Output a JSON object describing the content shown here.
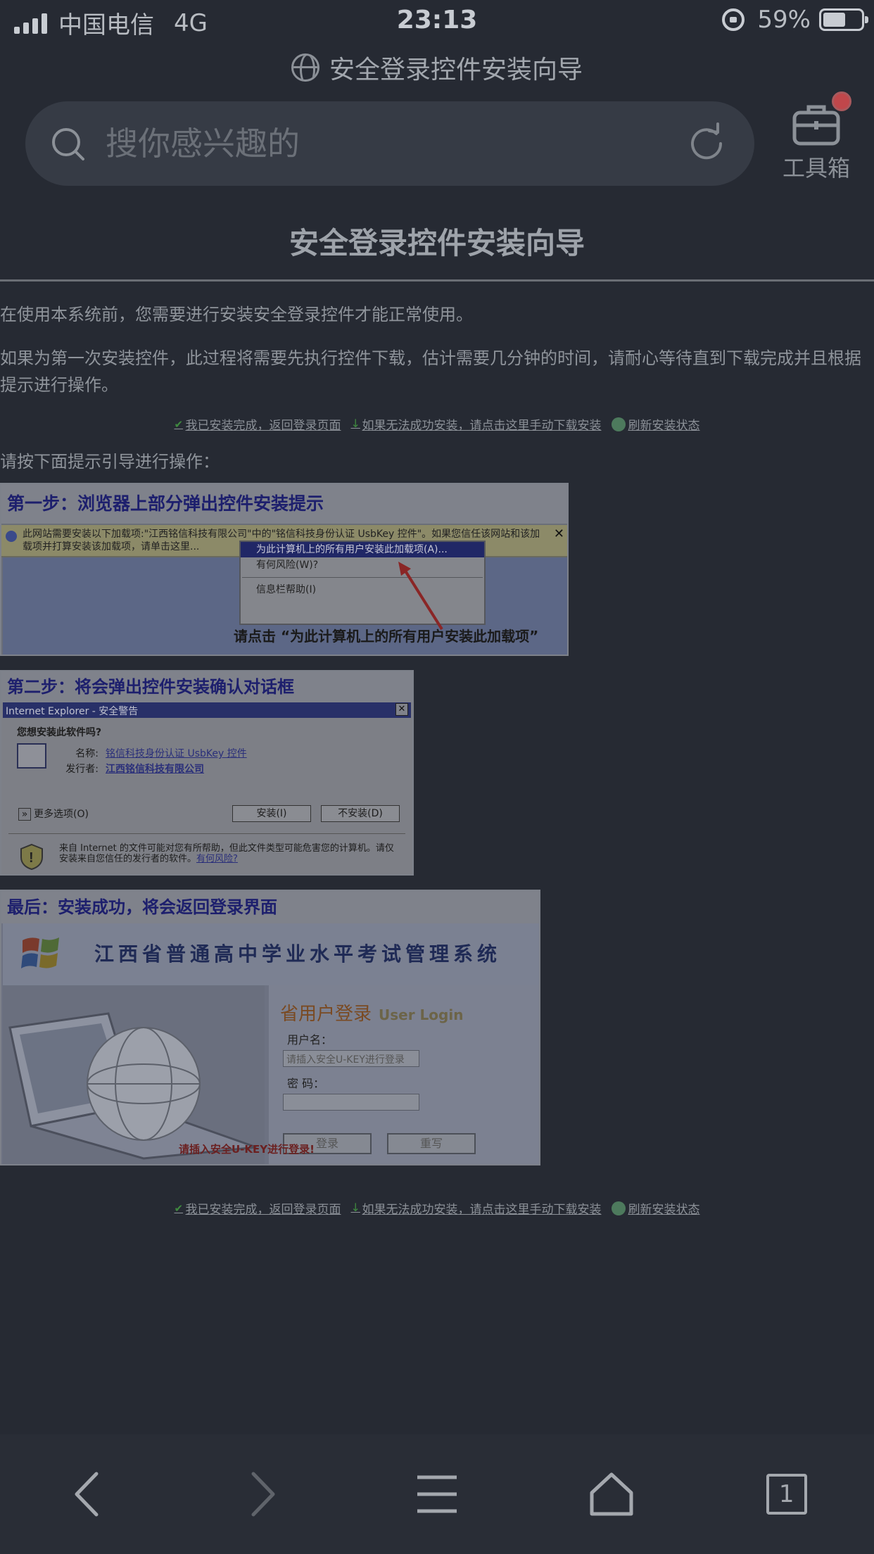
{
  "status_bar": {
    "carrier": "中国电信",
    "network": "4G",
    "time": "23:13",
    "battery_percent": "59%",
    "battery_level": 0.59
  },
  "page_title": "安全登录控件安装向导",
  "search": {
    "placeholder": "搜你感兴趣的"
  },
  "toolbox": {
    "label": "工具箱"
  },
  "content": {
    "title": "安全登录控件安装向导",
    "para1": "在使用本系统前，您需要进行安装安全登录控件才能正常使用。",
    "para2": "如果为第一次安装控件，此过程将需要先执行控件下载，估计需要几分钟的时间，请耐心等待直到下载完成并且根据提示进行操作。",
    "links": {
      "done": "我已安装完成，返回登录页面",
      "manual": "如果无法成功安装，请点击这里手动下载安装",
      "refresh": "刷新安装状态"
    },
    "guide_intro": "请按下面提示引导进行操作："
  },
  "step1": {
    "heading": "第一步：浏览器上部分弹出控件安装提示",
    "infobar_text": "此网站需要安装以下加载项:\"江西铭信科技有限公司\"中的\"铭信科技身份认证 UsbKey 控件\"。如果您信任该网站和该加载项并打算安装该加载项，请单击这里...",
    "menu_item1": "为此计算机上的所有用户安装此加载项(A)...",
    "menu_item2": "有何风险(W)?",
    "menu_item3": "信息栏帮助(I)",
    "note": "请点击 “为此计算机上的所有用户安装此加载项”"
  },
  "step2": {
    "heading": "第二步：将会弹出控件安装确认对话框",
    "dialog_title": "Internet Explorer - 安全警告",
    "question": "您想安装此软件吗?",
    "name_label": "名称:",
    "name_value": "铭信科技身份认证 UsbKey 控件",
    "publisher_label": "发行者:",
    "publisher_value": "江西铭信科技有限公司",
    "more_options": "更多选项(O)",
    "install_btn": "安装(I)",
    "no_install_btn": "不安装(D)",
    "warning": "来自 Internet 的文件可能对您有所帮助，但此文件类型可能危害您的计算机。请仅安装来自您信任的发行者的软件。",
    "risk_link": "有何风险?"
  },
  "step3": {
    "heading": "最后：安装成功，将会返回登录界面",
    "system_name": "江西省普通高中学业水平考试管理系统",
    "login_title": "省用户登录",
    "login_title_en": "User Login",
    "username_label": "用户名：",
    "username_value": "请插入安全U-KEY进行登录",
    "password_label": "密  码：",
    "login_btn": "登录",
    "reset_btn": "重写",
    "warn": "请插入安全U-KEY进行登录!"
  },
  "bottom_nav": {
    "tab_count": "1"
  }
}
